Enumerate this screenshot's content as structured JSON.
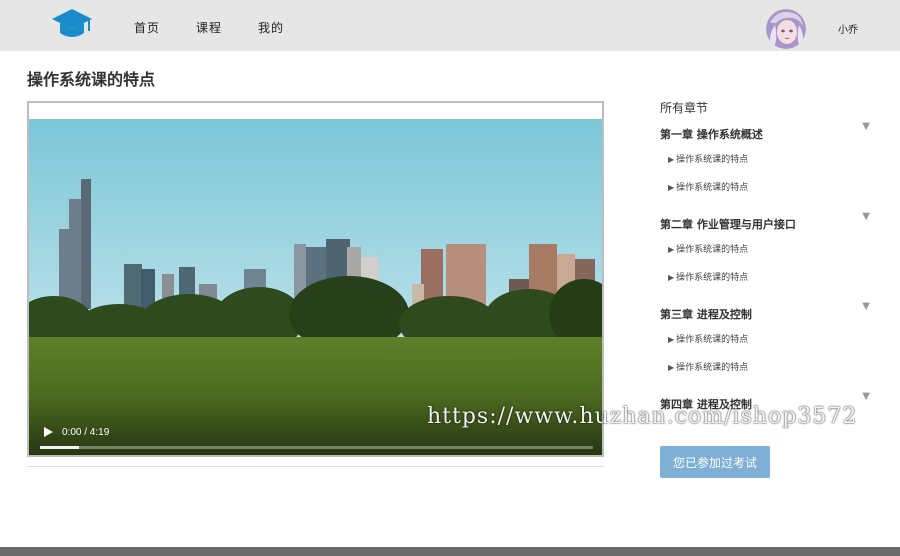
{
  "header": {
    "nav": [
      "首页",
      "课程",
      "我的"
    ],
    "user_name": "小乔"
  },
  "page_title": "操作系统课的特点",
  "video": {
    "time": "0:00 / 4:19",
    "progress": 0.0
  },
  "sidebar": {
    "title": "所有章节",
    "chapters": [
      {
        "title": "第一章 操作系统概述",
        "lessons": [
          "操作系统课的特点",
          "操作系统课的特点"
        ]
      },
      {
        "title": "第二章 作业管理与用户接口",
        "lessons": [
          "操作系统课的特点",
          "操作系统课的特点"
        ]
      },
      {
        "title": "第三章 进程及控制",
        "lessons": [
          "操作系统课的特点",
          "操作系统课的特点"
        ]
      },
      {
        "title": "第四章 进程及控制",
        "lessons": []
      }
    ],
    "lesson_marker": "▶",
    "toggle_icon": "▼",
    "exam_button": "您已参加过考试"
  },
  "watermark": "https://www.huzhan.com/ishop3572",
  "colors": {
    "header_bg": "#e6e6e6",
    "logo": "#1a8ccc",
    "exam_button": "#7eb0d6"
  }
}
